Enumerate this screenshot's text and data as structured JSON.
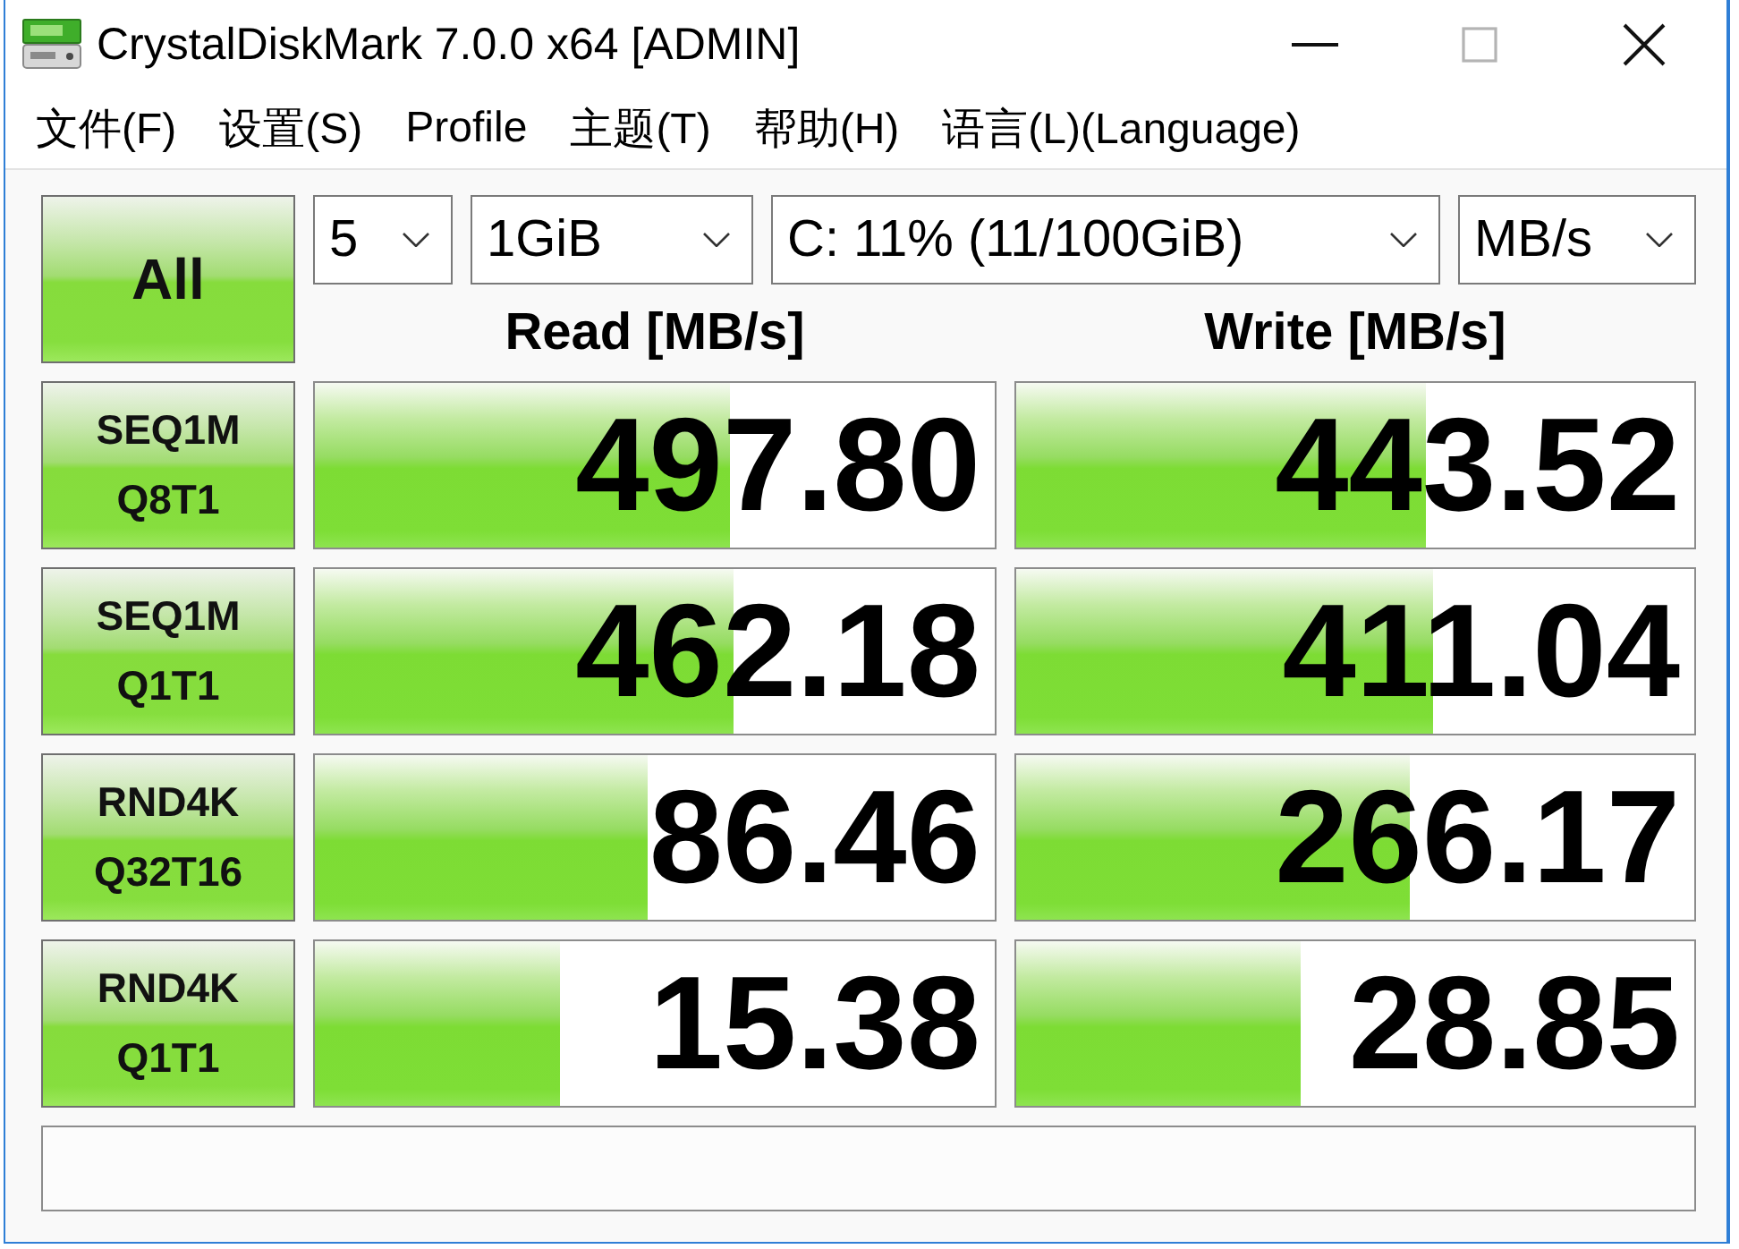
{
  "window": {
    "title": "CrystalDiskMark 7.0.0 x64 [ADMIN]",
    "maximize_button": {
      "disabled": true
    }
  },
  "menu": [
    {
      "label": "文件(F)"
    },
    {
      "label": "设置(S)"
    },
    {
      "label": "Profile"
    },
    {
      "label": "主题(T)"
    },
    {
      "label": "帮助(H)"
    },
    {
      "label": "语言(L)(Language)"
    }
  ],
  "all_button": {
    "label": "All"
  },
  "dropdowns": [
    {
      "value": "5"
    },
    {
      "value": "1GiB"
    },
    {
      "value": "C: 11% (11/100GiB)"
    },
    {
      "value": "MB/s"
    }
  ],
  "columns": [
    {
      "label": "Read [MB/s]"
    },
    {
      "label": "Write [MB/s]"
    }
  ],
  "tests": [
    {
      "name": "SEQ1M",
      "params": "Q8T1",
      "results": [
        {
          "value": "497.80",
          "level": 0.61
        },
        {
          "value": "443.52",
          "level": 0.605
        }
      ]
    },
    {
      "name": "SEQ1M",
      "params": "Q1T1",
      "results": [
        {
          "value": "462.18",
          "level": 0.617
        },
        {
          "value": "411.04",
          "level": 0.615
        }
      ]
    },
    {
      "name": "RND4K",
      "params": "Q32T16",
      "results": [
        {
          "value": "86.46",
          "level": 0.49
        },
        {
          "value": "266.17",
          "level": 0.58
        }
      ]
    },
    {
      "name": "RND4K",
      "params": "Q1T1",
      "results": [
        {
          "value": "15.38",
          "level": 0.36
        },
        {
          "value": "28.85",
          "level": 0.42
        }
      ]
    }
  ]
}
